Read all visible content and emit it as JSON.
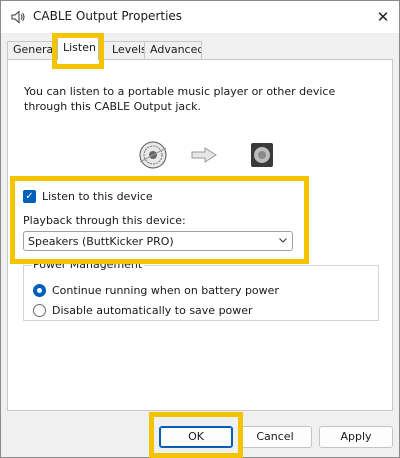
{
  "window": {
    "title": "CABLE Output Properties",
    "close_glyph": "✕"
  },
  "tabs": [
    {
      "label": "General",
      "active": false
    },
    {
      "label": "Listen",
      "active": true
    },
    {
      "label": "Levels",
      "active": false
    },
    {
      "label": "Advanced",
      "active": false
    }
  ],
  "listen": {
    "intro": "You can listen to a portable music player or other device through this CABLE Output jack.",
    "listen_checkbox_label": "Listen to this device",
    "listen_checked": true,
    "playback_label": "Playback through this device:",
    "playback_selected": "Speakers (ButtKicker PRO)"
  },
  "power": {
    "legend": "Power Management",
    "options": [
      {
        "label": "Continue running when on battery power",
        "checked": true
      },
      {
        "label": "Disable automatically to save power",
        "checked": false
      }
    ]
  },
  "buttons": {
    "ok": "OK",
    "cancel": "Cancel",
    "apply": "Apply"
  },
  "icons": {
    "title": "speaker-icon",
    "source_device": "cable-jack-icon",
    "arrow": "arrow-right-icon",
    "destination_device": "speaker-device-icon"
  },
  "colors": {
    "accent": "#005fb8",
    "highlight": "#f5c400"
  }
}
